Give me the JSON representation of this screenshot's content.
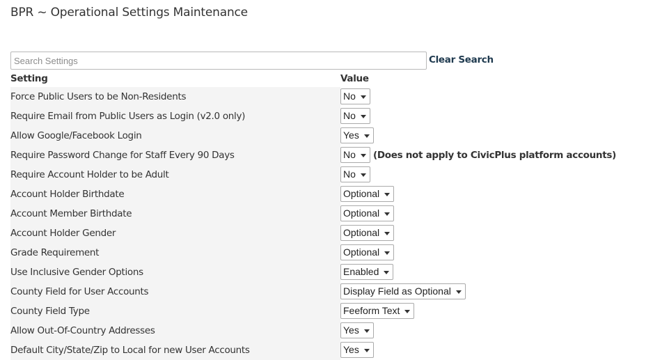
{
  "header": {
    "title": "BPR ~ Operational Settings Maintenance"
  },
  "search": {
    "placeholder": "Search Settings",
    "value": "",
    "clear_label": "Clear Search"
  },
  "table": {
    "columns": [
      "Setting",
      "Value"
    ],
    "rows": [
      {
        "label": "Force Public Users to be Non-Residents",
        "value": "No",
        "note": ""
      },
      {
        "label": "Require Email from Public Users as Login (v2.0 only)",
        "value": "No",
        "note": ""
      },
      {
        "label": "Allow Google/Facebook Login",
        "value": "Yes",
        "note": ""
      },
      {
        "label": "Require Password Change for Staff Every 90 Days",
        "value": "No",
        "note": "(Does not apply to CivicPlus platform accounts)"
      },
      {
        "label": "Require Account Holder to be Adult",
        "value": "No",
        "note": ""
      },
      {
        "label": "Account Holder Birthdate",
        "value": "Optional",
        "note": ""
      },
      {
        "label": "Account Member Birthdate",
        "value": "Optional",
        "note": ""
      },
      {
        "label": "Account Holder Gender",
        "value": "Optional",
        "note": ""
      },
      {
        "label": "Grade Requirement",
        "value": "Optional",
        "note": ""
      },
      {
        "label": "Use Inclusive Gender Options",
        "value": "Enabled",
        "note": ""
      },
      {
        "label": "County Field for User Accounts",
        "value": "Display Field as Optional",
        "note": ""
      },
      {
        "label": "County Field Type",
        "value": "Feeform Text",
        "note": ""
      },
      {
        "label": "Allow Out-Of-Country Addresses",
        "value": "Yes",
        "note": ""
      },
      {
        "label": "Default City/State/Zip to Local for new User Accounts",
        "value": "Yes",
        "note": ""
      }
    ]
  },
  "icons": {
    "dropdown": "chevron-down-icon"
  }
}
